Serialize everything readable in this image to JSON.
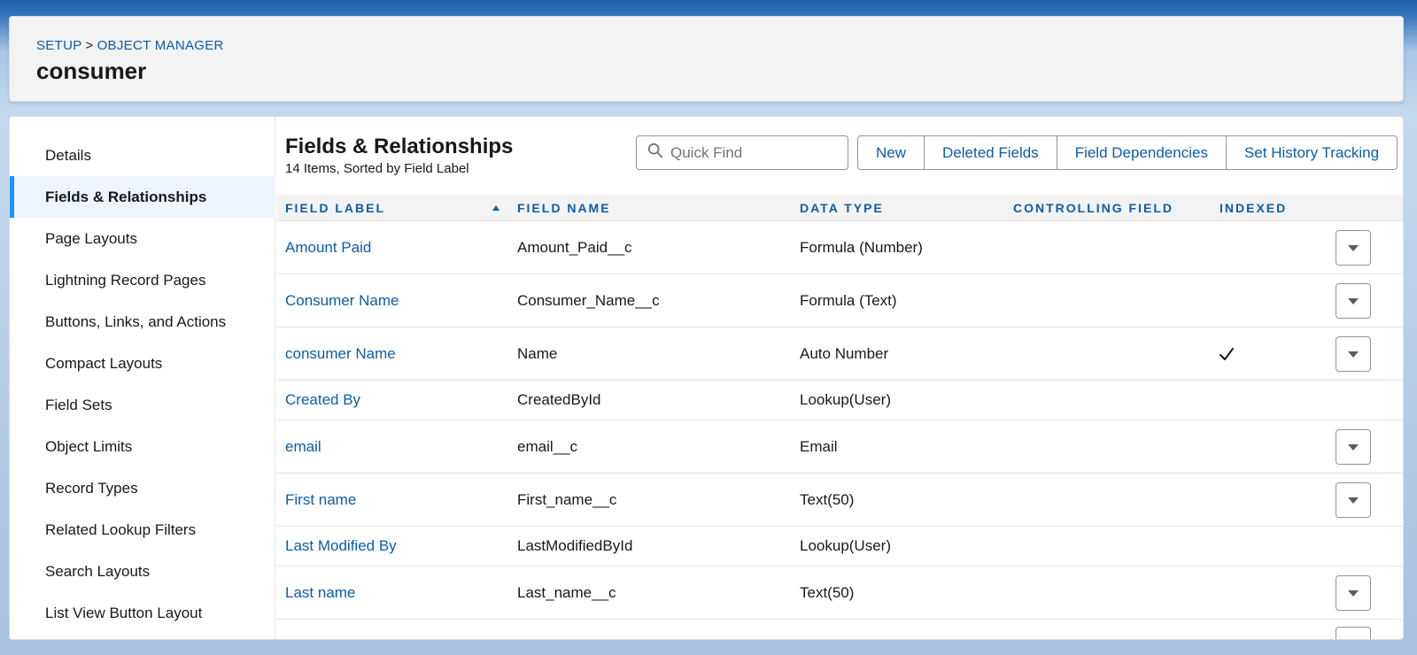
{
  "breadcrumb": {
    "root": "SETUP",
    "separator": ">",
    "current": "OBJECT MANAGER"
  },
  "page_title": "consumer",
  "sidebar": {
    "items": [
      {
        "label": "Details",
        "active": false
      },
      {
        "label": "Fields & Relationships",
        "active": true
      },
      {
        "label": "Page Layouts",
        "active": false
      },
      {
        "label": "Lightning Record Pages",
        "active": false
      },
      {
        "label": "Buttons, Links, and Actions",
        "active": false
      },
      {
        "label": "Compact Layouts",
        "active": false
      },
      {
        "label": "Field Sets",
        "active": false
      },
      {
        "label": "Object Limits",
        "active": false
      },
      {
        "label": "Record Types",
        "active": false
      },
      {
        "label": "Related Lookup Filters",
        "active": false
      },
      {
        "label": "Search Layouts",
        "active": false
      },
      {
        "label": "List View Button Layout",
        "active": false
      }
    ]
  },
  "section": {
    "title": "Fields & Relationships",
    "subtitle": "14 Items, Sorted by Field Label"
  },
  "search": {
    "placeholder": "Quick Find",
    "value": ""
  },
  "toolbar": {
    "new_label": "New",
    "deleted_fields_label": "Deleted Fields",
    "field_dependencies_label": "Field Dependencies",
    "history_tracking_label": "Set History Tracking"
  },
  "table": {
    "headers": {
      "field_label": "FIELD LABEL",
      "field_name": "FIELD NAME",
      "data_type": "DATA TYPE",
      "controlling_field": "CONTROLLING FIELD",
      "indexed": "INDEXED"
    },
    "sort": {
      "column": "field_label",
      "direction": "ascending"
    },
    "rows": [
      {
        "label": "Amount Paid",
        "name": "Amount_Paid__c",
        "type": "Formula (Number)",
        "controlling": "",
        "indexed": false,
        "has_menu": true
      },
      {
        "label": "Consumer Name",
        "name": "Consumer_Name__c",
        "type": "Formula (Text)",
        "controlling": "",
        "indexed": false,
        "has_menu": true
      },
      {
        "label": "consumer Name",
        "name": "Name",
        "type": "Auto Number",
        "controlling": "",
        "indexed": true,
        "has_menu": true
      },
      {
        "label": "Created By",
        "name": "CreatedById",
        "type": "Lookup(User)",
        "controlling": "",
        "indexed": false,
        "has_menu": false
      },
      {
        "label": "email",
        "name": "email__c",
        "type": "Email",
        "controlling": "",
        "indexed": false,
        "has_menu": true
      },
      {
        "label": "First name",
        "name": "First_name__c",
        "type": "Text(50)",
        "controlling": "",
        "indexed": false,
        "has_menu": true
      },
      {
        "label": "Last Modified By",
        "name": "LastModifiedById",
        "type": "Lookup(User)",
        "controlling": "",
        "indexed": false,
        "has_menu": false
      },
      {
        "label": "Last name",
        "name": "Last_name__c",
        "type": "Text(50)",
        "controlling": "",
        "indexed": false,
        "has_menu": true
      }
    ]
  },
  "colors": {
    "link": "#0b5cab",
    "active_bar": "#1b96ff",
    "active_bg": "#eef4ff"
  },
  "icons": {
    "search": "search-icon",
    "sort": "sort-ascending-icon",
    "check": "check-icon",
    "row_menu": "chevron-down-icon"
  }
}
